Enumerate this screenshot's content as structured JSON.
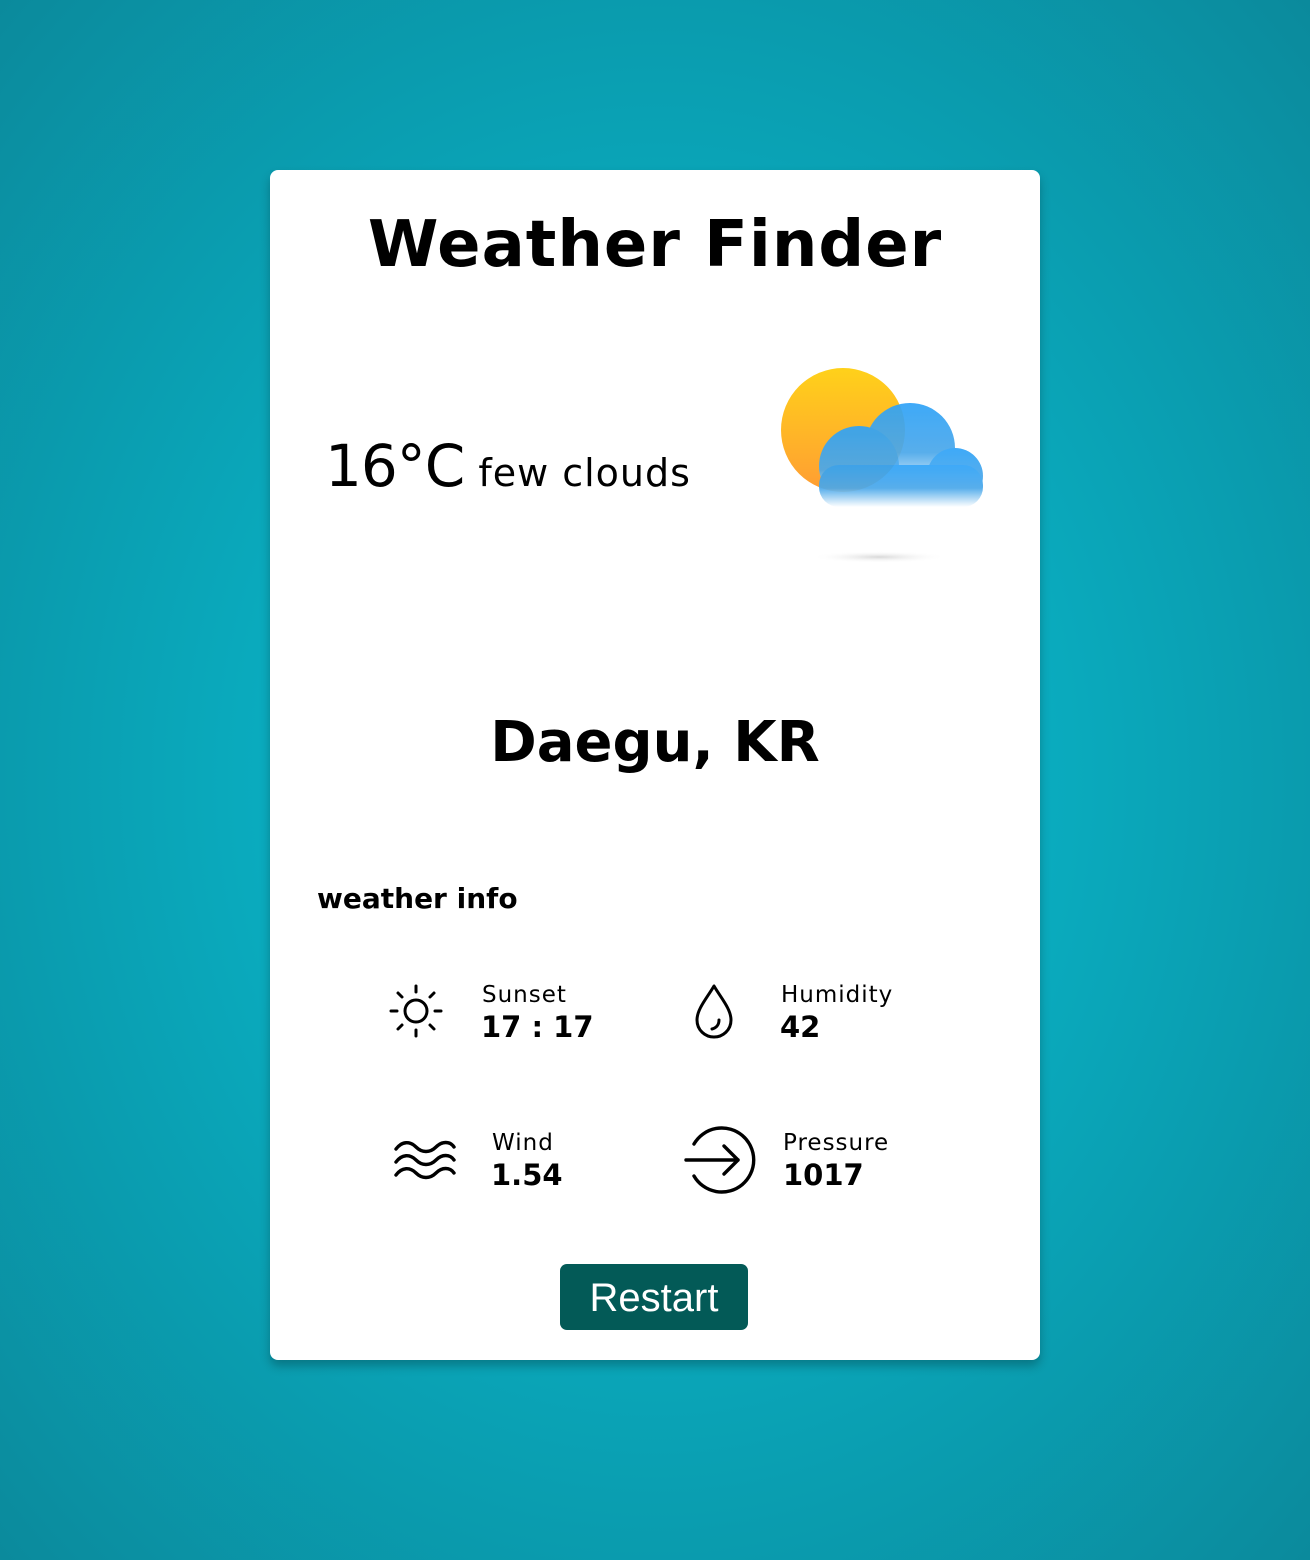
{
  "app": {
    "title": "Weather Finder"
  },
  "current": {
    "temperature": "16°C",
    "description": "few clouds",
    "icon": "sun-behind-cloud-icon"
  },
  "location": {
    "city": "Daegu, KR"
  },
  "info": {
    "heading": "weather info",
    "sunset": {
      "label": "Sunset",
      "value": "17 : 17",
      "icon": "sun-icon"
    },
    "humidity": {
      "label": "Humidity",
      "value": "42",
      "icon": "water-drop-icon"
    },
    "wind": {
      "label": "Wind",
      "value": "1.54",
      "icon": "wind-waves-icon"
    },
    "pressure": {
      "label": "Pressure",
      "value": "1017",
      "icon": "arrow-circle-icon"
    }
  },
  "actions": {
    "restart_label": "Restart"
  },
  "colors": {
    "background": "#0bc0d2",
    "card": "#ffffff",
    "button": "#035a57",
    "sun": "#ffb324",
    "cloud": "#2fa3f5"
  }
}
